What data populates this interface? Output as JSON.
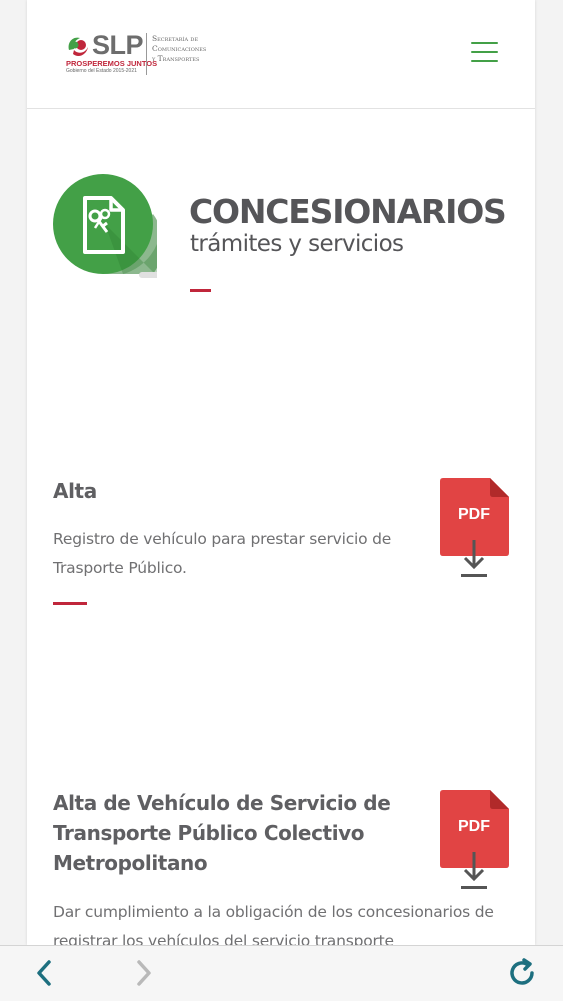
{
  "header": {
    "logo": {
      "brand": "SLP",
      "slogan": "PROSPEREMOS JUNTOS",
      "government": "Gobierno del Estado 2015-2021",
      "secretaria": "Secretaría de\nComunicaciones\ny Transportes"
    }
  },
  "hero": {
    "title": "CONCESIONARIOS",
    "subtitle": "trámites y servicios"
  },
  "items": [
    {
      "title": "Alta",
      "description": "Registro de vehículo para prestar servicio de Trasporte Público.",
      "pdf_label": "PDF"
    },
    {
      "title": "Alta de Vehículo de Servicio de Transporte Público Colectivo Metropolitano",
      "description": "Dar cumplimiento a la obligación de los concesionarios de registrar los vehículos del servicio transporte",
      "pdf_label": "PDF"
    }
  ],
  "toolbar": {
    "back": "back-icon",
    "forward": "forward-icon",
    "reload": "reload-icon"
  },
  "colors": {
    "accent_green": "#43a047",
    "accent_red": "#c0263b",
    "pdf_red": "#e14444",
    "toolbar_teal": "#1d6f7f"
  }
}
